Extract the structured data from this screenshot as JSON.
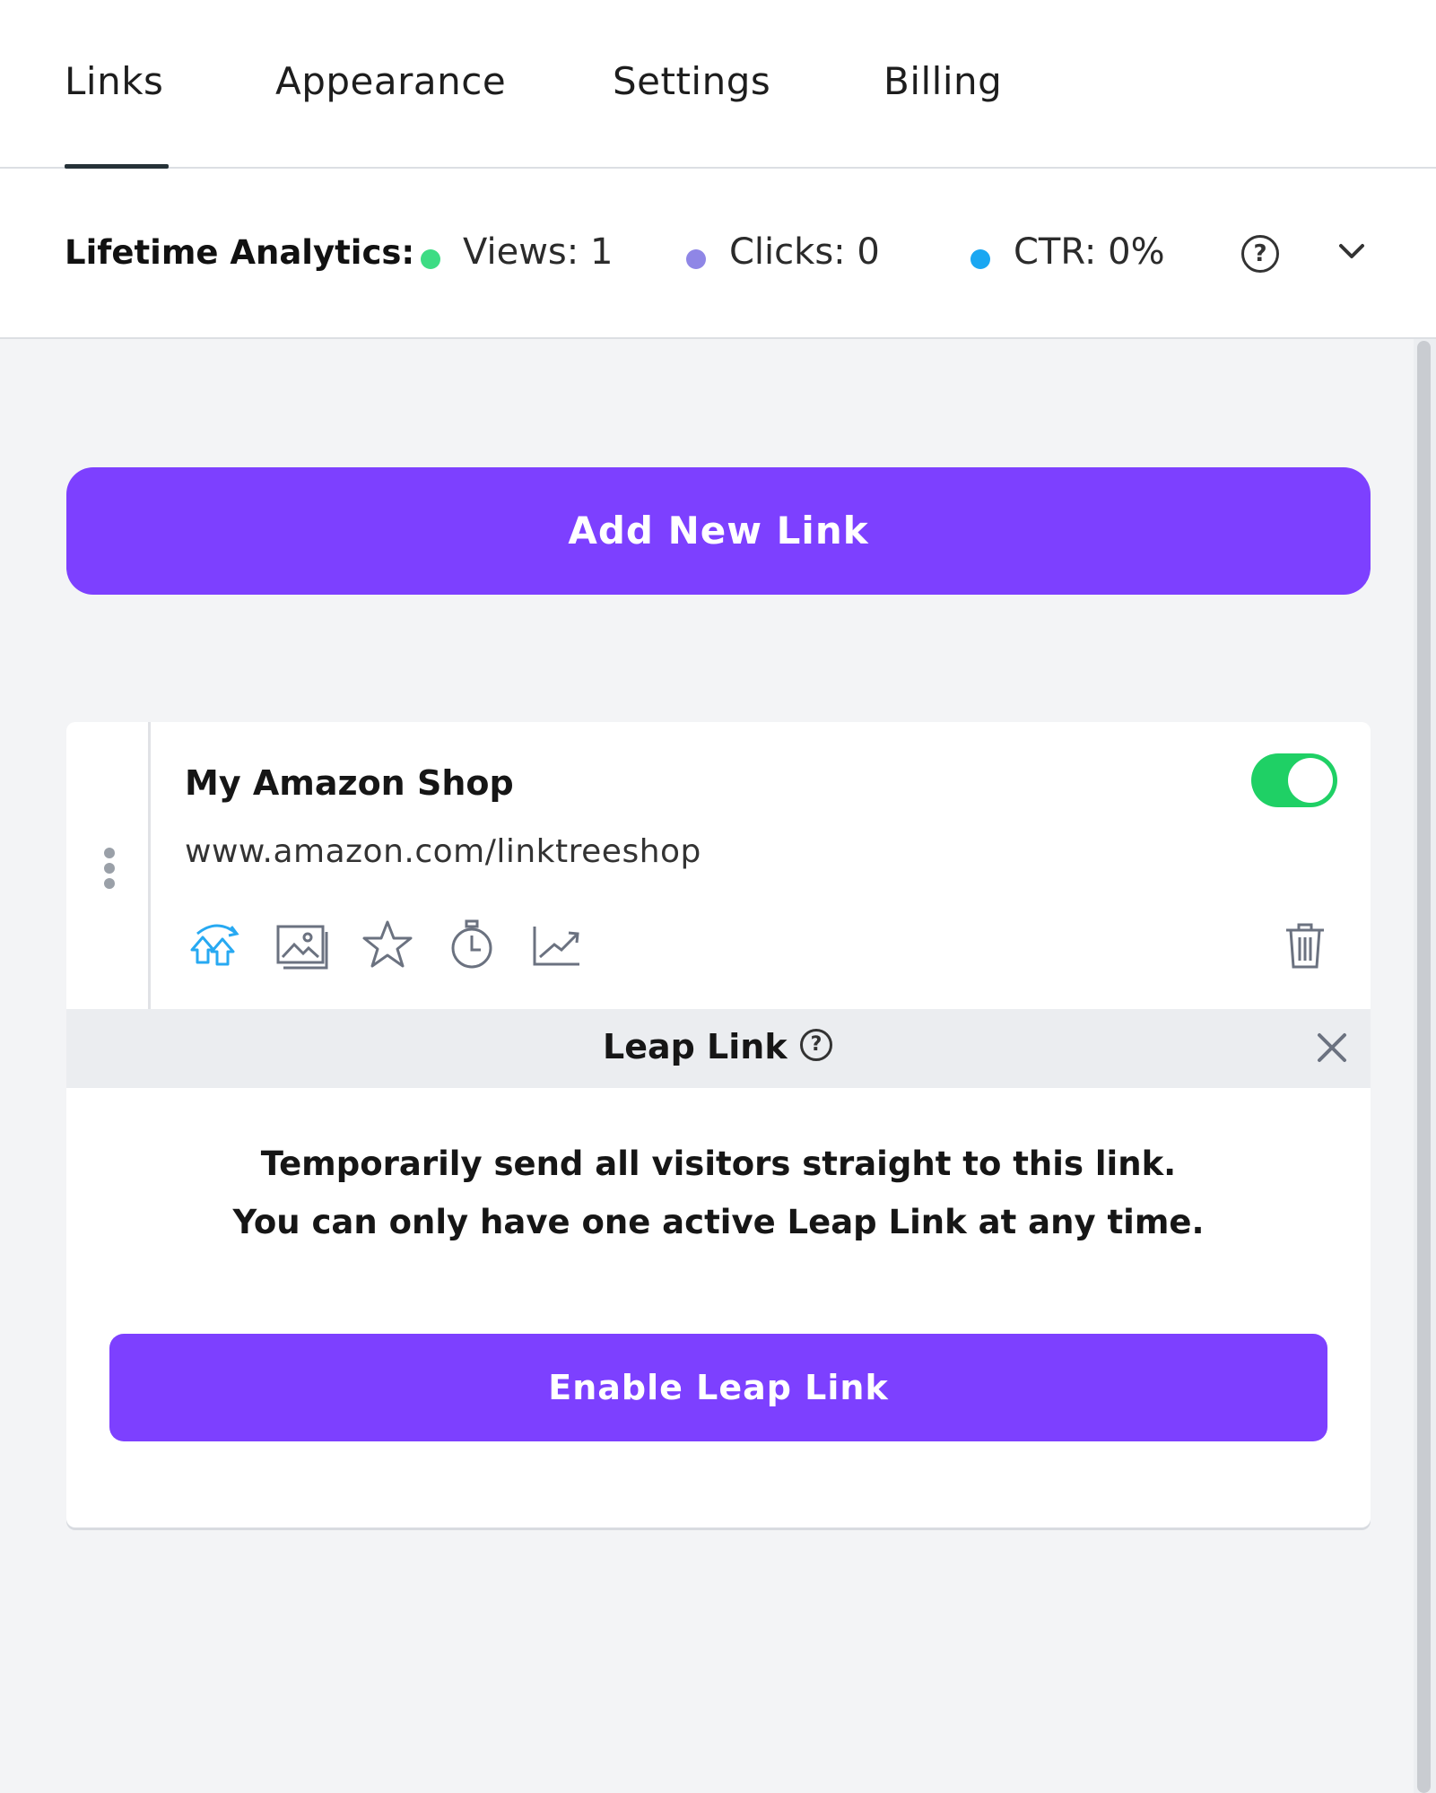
{
  "tabs": [
    {
      "label": "Links",
      "active": true
    },
    {
      "label": "Appearance",
      "active": false
    },
    {
      "label": "Settings",
      "active": false
    },
    {
      "label": "Billing",
      "active": false
    }
  ],
  "analytics": {
    "label": "Lifetime Analytics:",
    "views": "Views: 1",
    "clicks": "Clicks: 0",
    "ctr": "CTR: 0%",
    "help_glyph": "?",
    "colors": {
      "views": "#3ddc84",
      "clicks": "#8f86e6",
      "ctr": "#1aa7f2"
    }
  },
  "add_link_label": "Add New Link",
  "link_card": {
    "title": "My Amazon Shop",
    "url": "www.amazon.com/linktreeshop",
    "enabled": true,
    "tools": [
      "leap-link-icon",
      "thumbnail-icon",
      "priority-star-icon",
      "schedule-timer-icon",
      "analytics-chart-icon"
    ]
  },
  "leap_link": {
    "title": "Leap Link",
    "help_glyph": "?",
    "description_line1": "Temporarily send all visitors straight to this link.",
    "description_line2": "You can only have one active Leap Link at any time.",
    "button_label": "Enable Leap Link"
  },
  "colors": {
    "accent": "#7d40ff",
    "toggle_on": "#1fd065",
    "leap_icon": "#27a9f2"
  }
}
